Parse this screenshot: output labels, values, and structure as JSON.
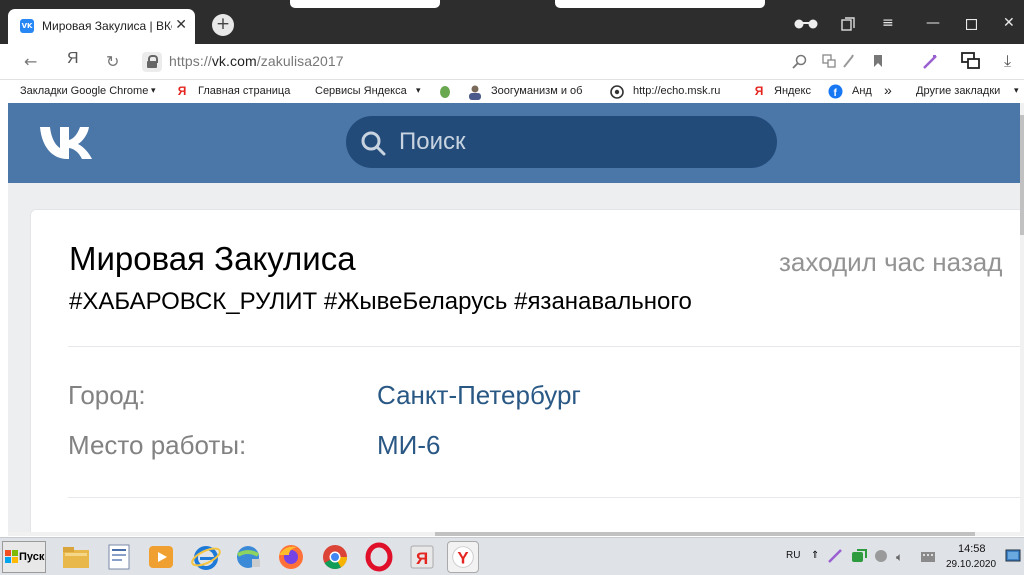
{
  "browser": {
    "tab_title": "Мировая Закулиса | ВКонтакте",
    "tab_close": "✕",
    "new_tab": "+",
    "url_prefix": "https://",
    "url_domain": "vk.com",
    "url_path": "/zakulisa2017",
    "bookmarks": [
      {
        "label": "Закладки Google Chrome",
        "icon": "folder-icon",
        "dropdown": "▾"
      },
      {
        "label": "Главная страница",
        "icon": "yandex-icon"
      },
      {
        "label": "Сервисы Яндекса",
        "icon": "",
        "dropdown": "▾"
      },
      {
        "label": "Зоогуманизм и об",
        "icon": "person-icon"
      },
      {
        "label": "http://echo.msk.ru",
        "icon": "echo-icon"
      },
      {
        "label": "Яндекс",
        "icon": "yandex-icon"
      },
      {
        "label": "Анд",
        "icon": "facebook-icon"
      },
      {
        "label": "Другие закладки",
        "dropdown": "▾"
      }
    ],
    "bookmarks_overflow": "»"
  },
  "vk": {
    "logo": "VK",
    "search_placeholder": "Поиск"
  },
  "profile": {
    "name": "Мировая Закулиса",
    "last_seen": "заходил час назад",
    "status": "#ХАБАРОВСК_РУЛИТ #ЖывеБеларусь #язанавального",
    "info": [
      {
        "label": "Город:",
        "value": "Санкт-Петербург"
      },
      {
        "label": "Место работы:",
        "value": "МИ-6"
      }
    ]
  },
  "taskbar": {
    "start_label": "Пуск",
    "language": "RU",
    "time": "14:58",
    "date": "29.10.2020"
  }
}
